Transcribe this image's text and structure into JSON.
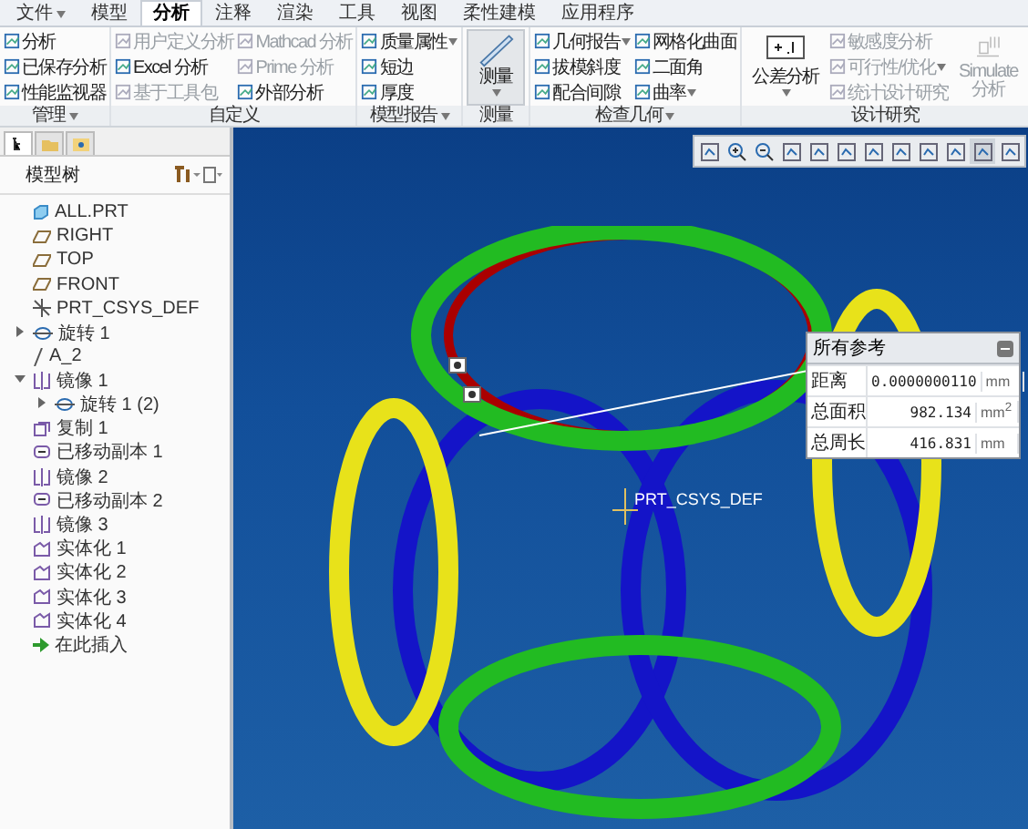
{
  "tabs": [
    {
      "label": "文件",
      "menu": true,
      "selected": false
    },
    {
      "label": "模型",
      "menu": false,
      "selected": false
    },
    {
      "label": "分析",
      "menu": false,
      "selected": true
    },
    {
      "label": "注释",
      "menu": false,
      "selected": false
    },
    {
      "label": "渲染",
      "menu": false,
      "selected": false
    },
    {
      "label": "工具",
      "menu": false,
      "selected": false
    },
    {
      "label": "视图",
      "menu": false,
      "selected": false
    },
    {
      "label": "柔性建模",
      "menu": false,
      "selected": false
    },
    {
      "label": "应用程序",
      "menu": false,
      "selected": false
    }
  ],
  "ribbon": [
    {
      "label": "管理",
      "menu": true,
      "columns": [
        [
          {
            "label": "分析",
            "kind": "small",
            "disabled": false,
            "menu": false
          },
          {
            "label": "已保存分析",
            "kind": "small",
            "disabled": false,
            "menu": false
          },
          {
            "label": "性能监视器",
            "kind": "small",
            "disabled": false,
            "menu": false
          }
        ]
      ]
    },
    {
      "label": "自定义",
      "menu": false,
      "columns": [
        [
          {
            "label": "用户定义分析",
            "kind": "small",
            "disabled": true,
            "menu": false
          },
          {
            "label": "Excel 分析",
            "kind": "small",
            "disabled": false,
            "menu": false
          },
          {
            "label": "基于工具包",
            "kind": "small",
            "disabled": true,
            "menu": false
          }
        ],
        [
          {
            "label": "Mathcad 分析",
            "kind": "small",
            "disabled": true,
            "menu": false
          },
          {
            "label": "Prime 分析",
            "kind": "small",
            "disabled": true,
            "menu": false
          },
          {
            "label": "外部分析",
            "kind": "small",
            "disabled": false,
            "menu": false
          }
        ]
      ]
    },
    {
      "label": "模型报告",
      "menu": true,
      "columns": [
        [
          {
            "label": "质量属性",
            "kind": "small",
            "disabled": false,
            "menu": true
          },
          {
            "label": "短边",
            "kind": "small",
            "disabled": false,
            "menu": false
          },
          {
            "label": "厚度",
            "kind": "small",
            "disabled": false,
            "menu": false
          }
        ]
      ]
    },
    {
      "label": "测量",
      "menu": false,
      "columns": [
        [
          {
            "label": "测量",
            "kind": "large",
            "disabled": false,
            "menu": true
          }
        ]
      ]
    },
    {
      "label": "检查几何",
      "menu": true,
      "columns": [
        [
          {
            "label": "几何报告",
            "kind": "small",
            "disabled": false,
            "menu": true
          },
          {
            "label": "拔模斜度",
            "kind": "small",
            "disabled": false,
            "menu": false
          },
          {
            "label": "配合间隙",
            "kind": "small",
            "disabled": false,
            "menu": false
          }
        ],
        [
          {
            "label": "网格化曲面",
            "kind": "small",
            "disabled": false,
            "menu": false
          },
          {
            "label": "二面角",
            "kind": "small",
            "disabled": false,
            "menu": false
          },
          {
            "label": "曲率",
            "kind": "small",
            "disabled": false,
            "menu": true
          }
        ]
      ]
    },
    {
      "label": "设计研究",
      "menu": false,
      "columns": [
        [
          {
            "label": "公差分析",
            "kind": "large",
            "disabled": false,
            "menu": true
          }
        ],
        [
          {
            "label": "敏感度分析",
            "kind": "small",
            "disabled": true,
            "menu": false
          },
          {
            "label": "可行性/优化",
            "kind": "small",
            "disabled": true,
            "menu": true
          },
          {
            "label": "统计设计研究",
            "kind": "small",
            "disabled": true,
            "menu": false
          }
        ],
        [
          {
            "label": "Simulate 分析",
            "kind": "large",
            "disabled": true,
            "menu": false
          }
        ]
      ]
    }
  ],
  "model_tree": {
    "title": "模型树",
    "items": [
      {
        "label": "ALL.PRT",
        "kind": "part"
      },
      {
        "label": "RIGHT",
        "kind": "plane"
      },
      {
        "label": "TOP",
        "kind": "plane"
      },
      {
        "label": "FRONT",
        "kind": "plane"
      },
      {
        "label": "PRT_CSYS_DEF",
        "kind": "csys"
      },
      {
        "label": "旋转 1",
        "kind": "revolve",
        "expanded": false
      },
      {
        "label": "A_2",
        "kind": "axis"
      },
      {
        "label": "镜像 1",
        "kind": "mirror",
        "expanded": true,
        "children": [
          {
            "label": "旋转 1 (2)",
            "kind": "revolve",
            "expanded": false
          }
        ]
      },
      {
        "label": "复制 1",
        "kind": "copy"
      },
      {
        "label": "已移动副本 1",
        "kind": "moved"
      },
      {
        "label": "镜像 2",
        "kind": "mirror"
      },
      {
        "label": "已移动副本 2",
        "kind": "moved"
      },
      {
        "label": "镜像 3",
        "kind": "mirror"
      },
      {
        "label": "实体化 1",
        "kind": "solidify"
      },
      {
        "label": "实体化 2",
        "kind": "solidify"
      },
      {
        "label": "实体化 3",
        "kind": "solidify"
      },
      {
        "label": "实体化 4",
        "kind": "solidify"
      },
      {
        "label": "在此插入",
        "kind": "insert"
      }
    ]
  },
  "viewport": {
    "csys_label": "PRT_CSYS_DEF",
    "measure_panel": {
      "title": "所有参考",
      "rows": [
        {
          "label": "距离",
          "value": "0.0000000110",
          "unit": "mm"
        },
        {
          "label": "总面积",
          "value": "982.134",
          "unit": "mm$^{2}$"
        },
        {
          "label": "总周长",
          "value": "416.831",
          "unit": "mm"
        }
      ]
    }
  }
}
